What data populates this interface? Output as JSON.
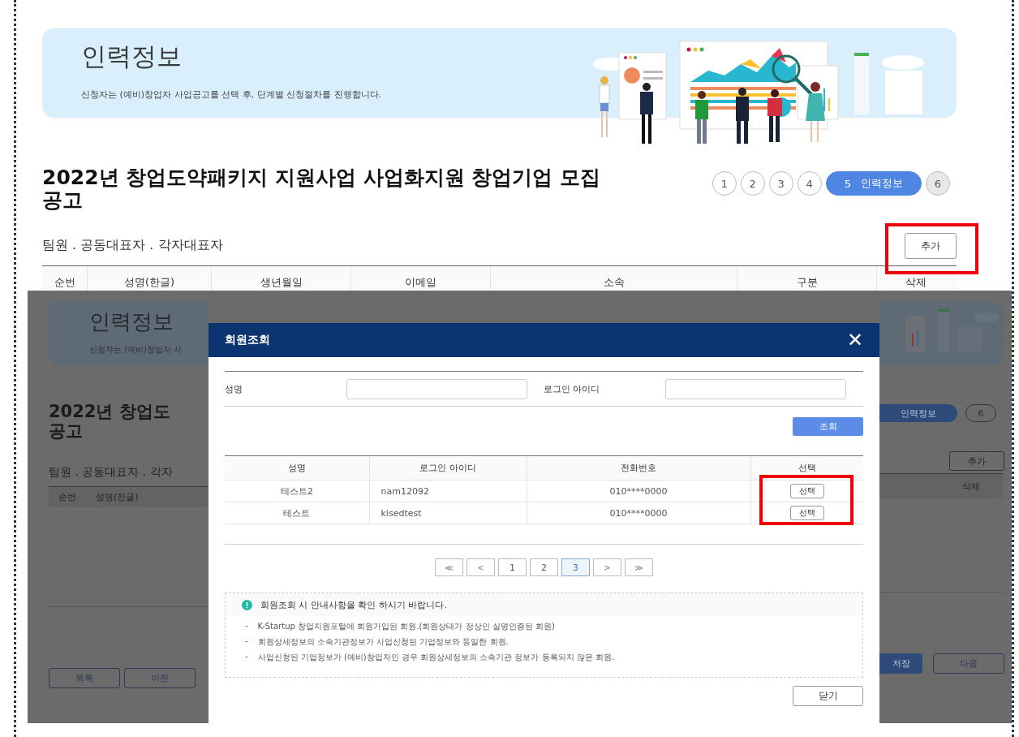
{
  "page": {
    "banner": {
      "title": "인력정보",
      "subtitle": "신청자는 (예비)창업자 사업공고를 선택 후, 단계별 신청절차를 진행합니다."
    },
    "title": "2022년 창업도약패키지 지원사업 사업화지원 창업기업 모집 공고",
    "steps": [
      {
        "number": "1",
        "selected": false
      },
      {
        "number": "2",
        "selected": false
      },
      {
        "number": "3",
        "selected": false
      },
      {
        "number": "4",
        "selected": false
      },
      {
        "number": "5",
        "label": "인력정보",
        "selected": true
      },
      {
        "number": "6",
        "selected": false
      }
    ],
    "section_label": "팀원 . 공동대표자 . 각자대표자",
    "add_button": "추가",
    "table": {
      "columns": [
        "순번",
        "성명(한글)",
        "생년월일",
        "이메일",
        "소속",
        "구분",
        "삭제"
      ]
    }
  },
  "background_page": {
    "banner": {
      "title": "인력정보",
      "subtitle": "신청자는 (예비)창업자 사"
    },
    "title": "2022년 창업도 공고",
    "section_label": "팀원 . 공동대표자 . 각자",
    "left_columns": [
      "순번",
      "성명(한글)"
    ],
    "left_buttons": [
      "목록",
      "이전"
    ],
    "steps": [
      {
        "label": "인력정보",
        "selected": true
      },
      {
        "number": "6",
        "selected": false
      }
    ],
    "add_button": "추가",
    "right_column": "삭제",
    "right_buttons": [
      {
        "label": "저장",
        "kind": "primary"
      },
      {
        "label": "다음",
        "kind": "default"
      }
    ]
  },
  "modal": {
    "title": "회원조회",
    "close": "✕",
    "fields": [
      {
        "label": "성명"
      },
      {
        "label": "로그인 아이디"
      }
    ],
    "search_button": "조회",
    "table": {
      "columns": [
        "성명",
        "로그인 아이디",
        "전화번호",
        "선택"
      ],
      "rows": [
        {
          "name": "테스트2",
          "login_id": "nam12092",
          "phone": "010****0000",
          "action": "선택"
        },
        {
          "name": "테스트",
          "login_id": "kisedtest",
          "phone": "010****0000",
          "action": "선택"
        }
      ]
    },
    "pagination": [
      {
        "label": "≪",
        "kind": "nav",
        "selected": false
      },
      {
        "label": "<",
        "kind": "nav",
        "selected": false
      },
      {
        "label": "1",
        "kind": "page",
        "selected": false
      },
      {
        "label": "2",
        "kind": "page",
        "selected": false
      },
      {
        "label": "3",
        "kind": "page",
        "selected": true
      },
      {
        "label": ">",
        "kind": "nav",
        "selected": false
      },
      {
        "label": "≫",
        "kind": "nav",
        "selected": false
      }
    ],
    "notice": {
      "title": "회원조회 시 안내사항을 확인 하시기 바랍니다.",
      "items": [
        {
          "marker": "-",
          "text": "K-Startup 창업지원포털에 회원가입된 회원.(회원상태가 정상인 실명인증된 회원)"
        },
        {
          "marker": "-",
          "text": "회원상세정보의 소속기관정보가 사업신청된 기업정보와 동일한 회원."
        },
        {
          "marker": "-",
          "text": "사업신청된 기업정보가 (예비)창업자인 경우 회원상세정보의 소속기관 정보가 등록되지 않은 회원."
        }
      ]
    },
    "close_button": "닫기"
  }
}
